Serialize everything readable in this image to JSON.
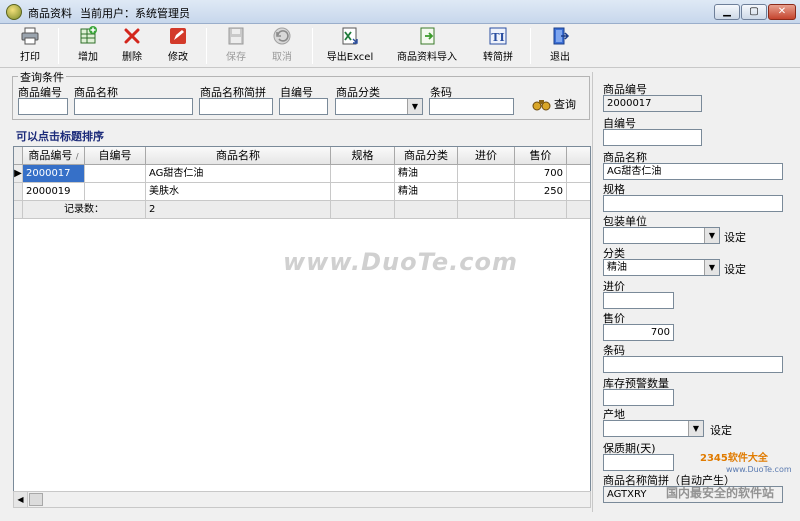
{
  "window": {
    "title": "商品资料",
    "user_text": "当前用户：系统管理员"
  },
  "toolbar": {
    "print": "打印",
    "add": "增加",
    "delete": "删除",
    "edit": "修改",
    "save": "保存",
    "cancel": "取消",
    "export_excel": "导出Excel",
    "import": "商品资料导入",
    "convert": "转简拼",
    "exit": "退出"
  },
  "query": {
    "legend": "查询条件",
    "code_label": "商品编号",
    "name_label": "商品名称",
    "pinyin_label": "商品名称简拼",
    "selfcode_label": "自编号",
    "category_label": "商品分类",
    "barcode_label": "条码",
    "query_button": "查询"
  },
  "sort_hint": "可以点击标题排序",
  "grid": {
    "columns": [
      "商品编号",
      "自编号",
      "商品名称",
      "规格",
      "商品分类",
      "进价",
      "售价"
    ],
    "rows": [
      {
        "code": "2000017",
        "selfcode": "",
        "name": "AG甜杏仁油",
        "spec": "",
        "category": "精油",
        "cost": "",
        "price": "700"
      },
      {
        "code": "2000019",
        "selfcode": "",
        "name": "美肤水",
        "spec": "",
        "category": "精油",
        "cost": "",
        "price": "250"
      }
    ],
    "footer_label": "记录数：",
    "footer_count": "2"
  },
  "detail": {
    "code_label": "商品编号",
    "code_value": "2000017",
    "selfcode_label": "自编号",
    "selfcode_value": "",
    "name_label": "商品名称",
    "name_value": "AG甜杏仁油",
    "spec_label": "规格",
    "spec_value": "",
    "unit_label": "包装单位",
    "unit_value": "",
    "set_label": "设定",
    "category_label": "分类",
    "category_value": "精油",
    "cost_label": "进价",
    "cost_value": "",
    "price_label": "售价",
    "price_value": "700",
    "barcode_label": "条码",
    "barcode_value": "",
    "stock_alert_label": "库存预警数量",
    "stock_alert_value": "",
    "origin_label": "产地",
    "origin_value": "",
    "shelf_life_label": "保质期(天)",
    "shelf_life_value": "",
    "pinyin_label": "商品名称简拼（自动产生）",
    "pinyin_value": "AGTXRY"
  },
  "watermarks": {
    "main": "www.DuoTe.com",
    "brand": "2345软件大全",
    "brand_url": "www.DuoTe.com",
    "slogan": "国内最安全的软件站"
  },
  "colors": {
    "selected_cell": "#3670c8",
    "hint_text": "#1c2b7a"
  }
}
